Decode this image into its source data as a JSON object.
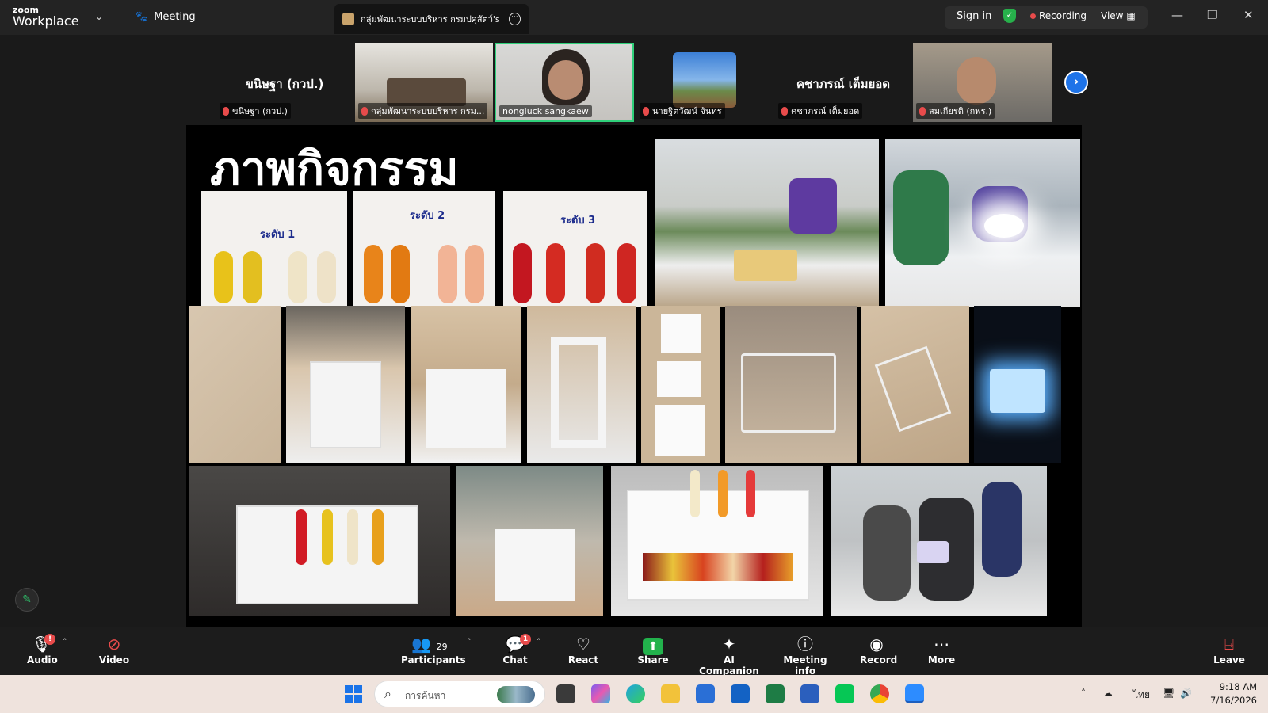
{
  "titlebar": {
    "logo_small": "zoom",
    "logo_big": "Workplace",
    "meeting_tab": "Meeting",
    "doc_tab_title": "กลุ่มพัฒนาระบบบริหาร กรมปศุสัตว์'s sc",
    "sign_in": "Sign in",
    "recording": "Recording",
    "view": "View"
  },
  "participants_strip": [
    {
      "big_name": "ขนิษฐา (กวป.)",
      "label": "ขนิษฐา (กวป.)",
      "type": "name"
    },
    {
      "big_name": "",
      "label": "กลุ่มพัฒนาระบบบริหาร กรม...",
      "type": "video"
    },
    {
      "big_name": "",
      "label": "nongluck sangkaew",
      "type": "video-active"
    },
    {
      "big_name": "",
      "label": "นายฐิตวัฒน์ จันทร",
      "type": "image"
    },
    {
      "big_name": "คชาภรณ์ เต็มยอด",
      "label": "คชาภรณ์ เต็มยอด",
      "type": "name"
    },
    {
      "big_name": "",
      "label": "สมเกียรติ (กพร.)",
      "type": "video"
    }
  ],
  "slide": {
    "title": "ภาพกิจกรรม",
    "tube_labels": [
      "ระดับ 1",
      "ระดับ 2",
      "ระดับ 3"
    ]
  },
  "toolbar": {
    "audio": "Audio",
    "video": "Video",
    "participants": "Participants",
    "participants_count": "29",
    "chat": "Chat",
    "chat_badge": "1",
    "react": "React",
    "share": "Share",
    "ai_companion": "AI Companion",
    "meeting_info": "Meeting info",
    "record": "Record",
    "more": "More",
    "leave": "Leave"
  },
  "taskbar": {
    "search_placeholder": "การค้นหา",
    "lang": "ไทย",
    "time": "9:18 AM",
    "date": "7/16/2026"
  },
  "colors": {
    "accent_blue": "#1e73e8",
    "record_red": "#e84b4b",
    "share_green": "#22b24c",
    "active_speaker": "#2fd07a"
  }
}
